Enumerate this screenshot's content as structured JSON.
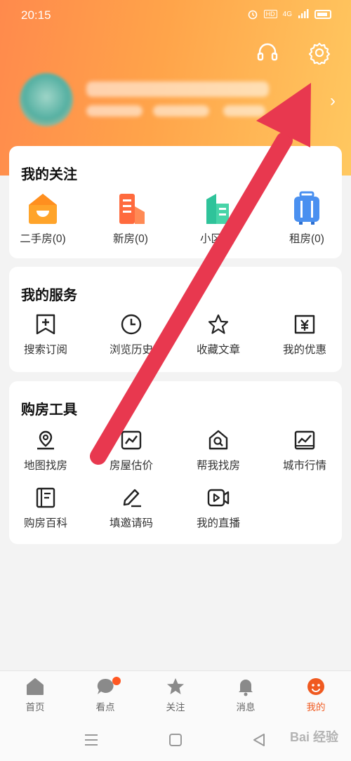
{
  "status_bar": {
    "time": "20:15",
    "hd_badge": "HD",
    "network": "4G"
  },
  "colors": {
    "accent": "#f05a20",
    "header_start": "#ff8a4c",
    "header_end": "#ffc860",
    "annotation_arrow": "#e8384f"
  },
  "header": {
    "support_icon": "headset-icon",
    "settings_icon": "gear-icon"
  },
  "profile": {
    "chevron": "›"
  },
  "follow": {
    "title": "我的关注",
    "items": [
      {
        "label": "二手房(0)",
        "icon": "second-hand-house-icon"
      },
      {
        "label": "新房(0)",
        "icon": "new-house-icon"
      },
      {
        "label": "小区(0)",
        "icon": "community-icon"
      },
      {
        "label": "租房(0)",
        "icon": "rental-icon"
      }
    ]
  },
  "services": {
    "title": "我的服务",
    "items": [
      {
        "label": "搜索订阅",
        "icon": "bookmark-plus-icon"
      },
      {
        "label": "浏览历史",
        "icon": "clock-icon"
      },
      {
        "label": "收藏文章",
        "icon": "star-icon"
      },
      {
        "label": "我的优惠",
        "icon": "coupon-icon"
      }
    ]
  },
  "tools": {
    "title": "购房工具",
    "items": [
      {
        "label": "地图找房",
        "icon": "map-pin-icon"
      },
      {
        "label": "房屋估价",
        "icon": "trend-icon"
      },
      {
        "label": "帮我找房",
        "icon": "house-search-icon"
      },
      {
        "label": "城市行情",
        "icon": "chart-icon"
      },
      {
        "label": "购房百科",
        "icon": "book-icon"
      },
      {
        "label": "填邀请码",
        "icon": "pen-icon"
      },
      {
        "label": "我的直播",
        "icon": "video-icon"
      }
    ]
  },
  "tabbar": {
    "items": [
      {
        "label": "首页",
        "icon": "home-icon"
      },
      {
        "label": "看点",
        "icon": "chat-bubble-icon"
      },
      {
        "label": "关注",
        "icon": "star-icon"
      },
      {
        "label": "消息",
        "icon": "bell-icon"
      },
      {
        "label": "我的",
        "icon": "profile-icon"
      }
    ],
    "active_index": 4
  },
  "watermark": "Bai 经验"
}
